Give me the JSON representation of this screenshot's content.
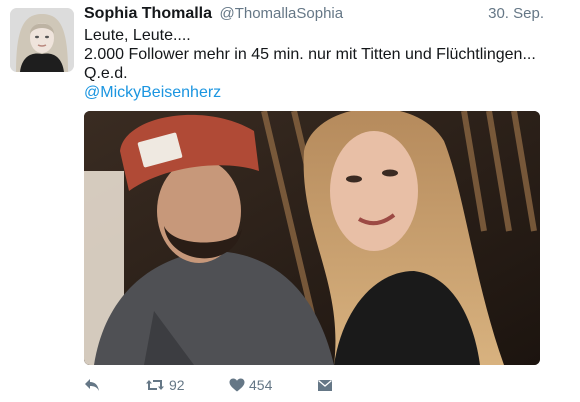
{
  "tweet": {
    "author_name": "Sophia Thomalla",
    "author_handle": "@ThomallaSophia",
    "date": "30. Sep.",
    "lines": [
      "Leute, Leute....",
      "2.000 Follower mehr in 45 min. nur mit Titten und Flüchtlingen...",
      "Q.e.d."
    ],
    "mention": "@MickyBeisenherz",
    "mention_color": "#1b95e0"
  },
  "actions": {
    "reply_icon": "reply-icon",
    "retweet_icon": "retweet-icon",
    "retweet_count": "92",
    "like_icon": "heart-icon",
    "like_count": "454",
    "dm_icon": "envelope-icon"
  }
}
